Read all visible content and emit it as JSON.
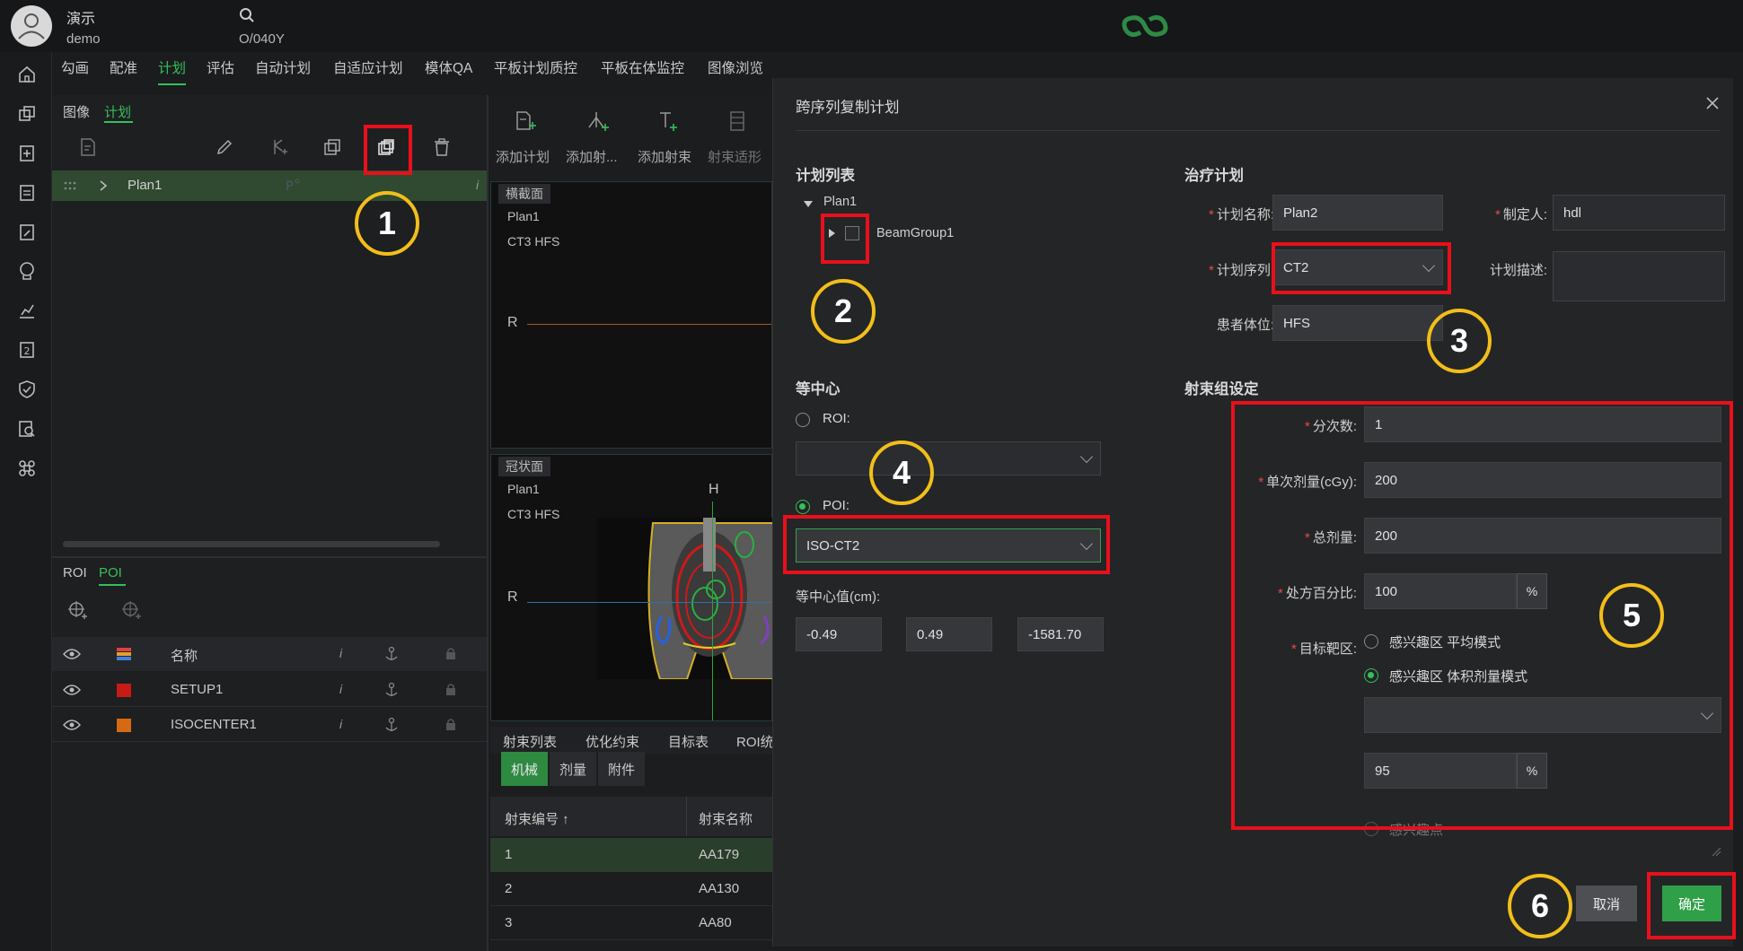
{
  "header": {
    "user_name": "演示",
    "user_id": "demo",
    "patient_id": "O/040Y"
  },
  "menu_tabs": [
    "勾画",
    "配准",
    "计划",
    "评估",
    "自动计划",
    "自适应计划",
    "模体QA",
    "平板计划质控",
    "平板在体监控",
    "图像浏览"
  ],
  "left_panel": {
    "subtabs": [
      "图像",
      "计划"
    ],
    "plan_name": "Plan1",
    "roi_tabs": [
      "ROI",
      "POI"
    ],
    "poi_table": {
      "header_name": "名称",
      "rows": [
        {
          "name": "SETUP1",
          "color": "#c61b16"
        },
        {
          "name": "ISOCENTER1",
          "color": "#d66a14"
        }
      ]
    }
  },
  "center": {
    "toolbar": [
      "添加计划",
      "添加射...",
      "添加射束",
      "射束适形"
    ],
    "axial": {
      "label": "横截面",
      "plan": "Plan1",
      "series": "CT3 HFS",
      "orient": "R"
    },
    "coronal": {
      "label": "冠状面",
      "plan": "Plan1",
      "series": "CT3 HFS",
      "orient_top": "H",
      "orient_left": "R"
    },
    "bottom_tabs": [
      "射束列表",
      "优化约束",
      "目标表",
      "ROI统"
    ],
    "sub_tabs": [
      "机械",
      "剂量",
      "附件"
    ],
    "beam_table": {
      "col1": "射束编号 ↑",
      "col2": "射束名称",
      "rows": [
        {
          "id": "1",
          "name": "AA179"
        },
        {
          "id": "2",
          "name": "AA130"
        },
        {
          "id": "3",
          "name": "AA80"
        }
      ]
    }
  },
  "dialog": {
    "title": "跨序列复制计划",
    "plan_list": {
      "title": "计划列表",
      "plan": "Plan1",
      "beam_group": "BeamGroup1"
    },
    "isocenter": {
      "title": "等中心",
      "roi_label": "ROI:",
      "poi_label": "POI:",
      "poi_value": "ISO-CT2",
      "value_label": "等中心值(cm):",
      "values": [
        "-0.49",
        "0.49",
        "-1581.70"
      ]
    },
    "treatment_plan": {
      "title": "治疗计划",
      "plan_name_label": "计划名称:",
      "plan_name": "Plan2",
      "creator_label": "制定人:",
      "creator": "hdl",
      "series_label": "计划序列:",
      "series": "CT2",
      "desc_label": "计划描述:",
      "position_label": "患者体位:",
      "position": "HFS"
    },
    "beam_group": {
      "title": "射束组设定",
      "fractions_label": "分次数:",
      "fractions": "1",
      "dose_per_label": "单次剂量(cGy):",
      "dose_per": "200",
      "total_label": "总剂量:",
      "total": "200",
      "rx_pct_label": "处方百分比:",
      "rx_pct": "100",
      "pct_unit": "%",
      "target_label": "目标靶区:",
      "target_opt1": "感兴趣区 平均模式",
      "target_opt2": "感兴趣区 体积剂量模式",
      "volume_pct": "95",
      "target_opt3": "感兴趣点"
    },
    "cancel": "取消",
    "ok": "确定"
  },
  "callouts": [
    "1",
    "2",
    "3",
    "4",
    "5",
    "6"
  ],
  "colors": {
    "accent": "#34c05a",
    "annotation_red": "#e8101a",
    "callout_yellow": "#f2be1a"
  }
}
